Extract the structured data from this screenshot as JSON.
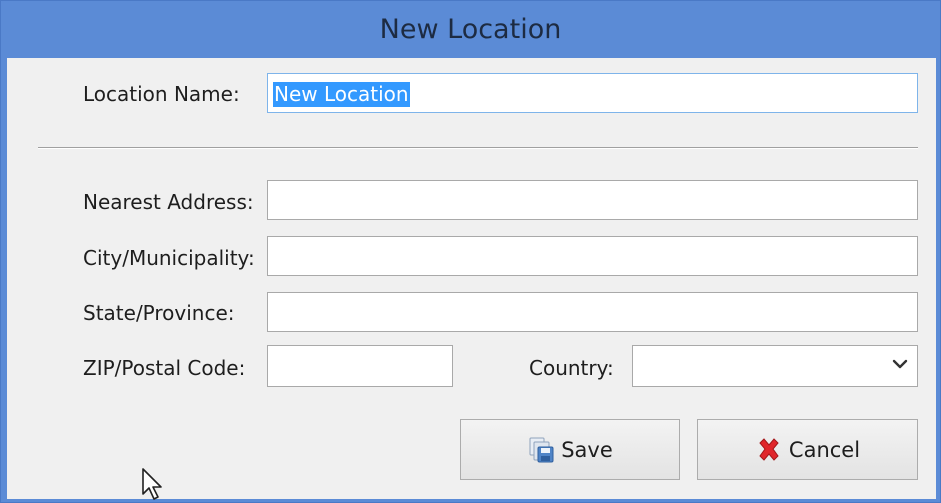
{
  "window": {
    "title": "New Location"
  },
  "form": {
    "location_name_label": "Location Name:",
    "location_name_value": "New Location",
    "nearest_address_label": "Nearest Address:",
    "nearest_address_value": "",
    "city_label": "City/Municipality:",
    "city_value": "",
    "state_label": "State/Province:",
    "state_value": "",
    "zip_label": "ZIP/Postal Code:",
    "zip_value": "",
    "country_label": "Country:",
    "country_value": ""
  },
  "buttons": {
    "save_label": "Save",
    "cancel_label": "Cancel"
  },
  "icons": {
    "save": "save-disk-icon",
    "cancel": "red-x-icon",
    "country_dropdown": "chevron-down-icon",
    "cursor": "mouse-pointer-icon"
  },
  "colors": {
    "titlebar": "#5b8bd6",
    "selection": "#3399ff",
    "cancel_x": "#e0262b"
  }
}
